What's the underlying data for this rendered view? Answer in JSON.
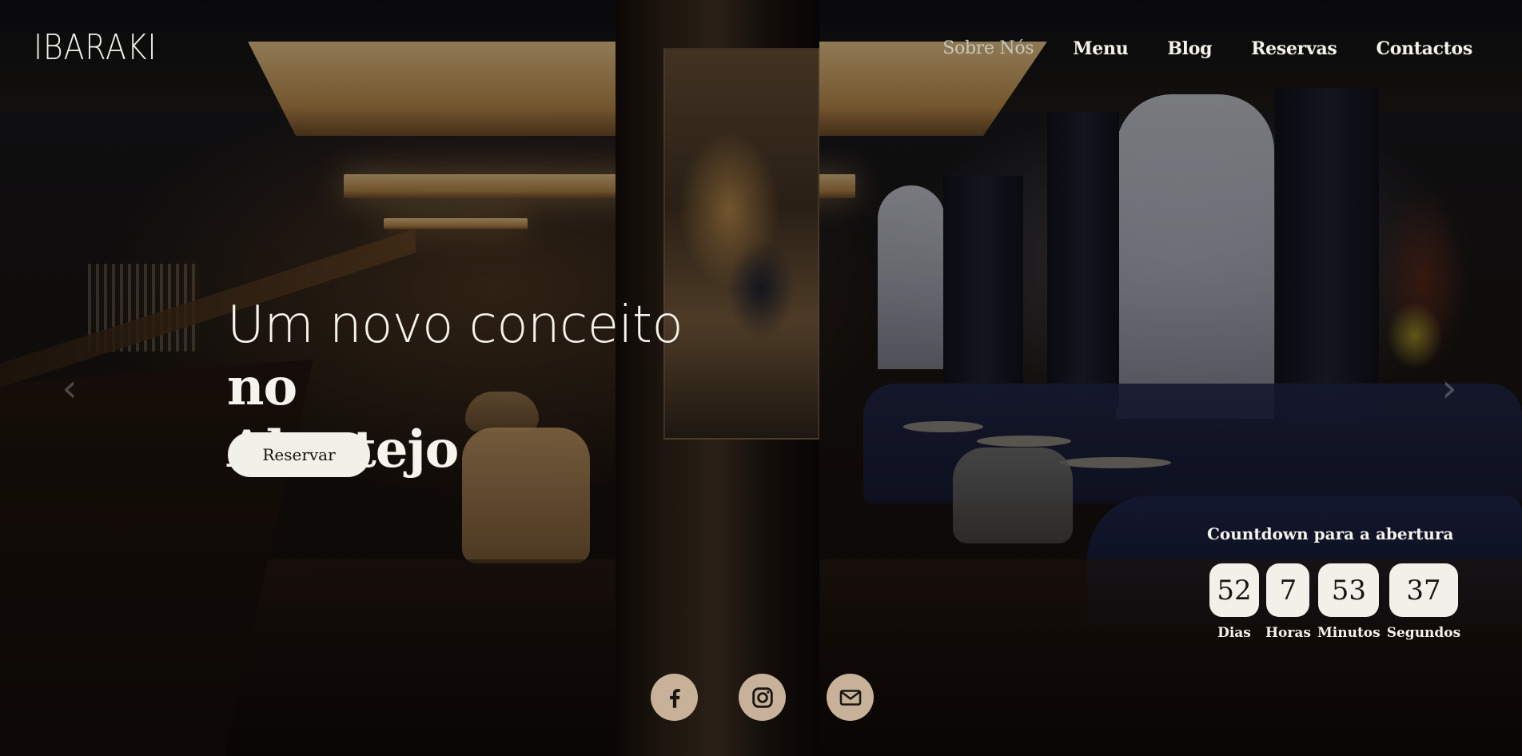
{
  "brand": {
    "logo_text": "IBARAKI"
  },
  "nav": {
    "items": [
      {
        "label": "Sobre Nós",
        "active": false
      },
      {
        "label": "Menu"
      },
      {
        "label": "Blog"
      },
      {
        "label": "Reservas"
      },
      {
        "label": "Contactos"
      }
    ]
  },
  "hero": {
    "title_light": "Um novo conceito ",
    "title_bold_1": "no",
    "title_bold_2": "Alentejo",
    "cta_label": "Reservar"
  },
  "carousel": {
    "prev_icon": "chevron-left-icon",
    "next_icon": "chevron-right-icon"
  },
  "countdown": {
    "title": "Countdown para a abertura",
    "units": [
      {
        "value": "52",
        "label": "Dias"
      },
      {
        "value": "7",
        "label": "Horas"
      },
      {
        "value": "53",
        "label": "Minutos"
      },
      {
        "value": "37",
        "label": "Segundos"
      }
    ]
  },
  "socials": {
    "items": [
      {
        "icon": "facebook-icon"
      },
      {
        "icon": "instagram-icon"
      },
      {
        "icon": "mail-icon"
      }
    ]
  },
  "colors": {
    "text": "#f4f2ea",
    "button_bg": "#f2f1e9",
    "social_bg": "#c7b299"
  }
}
